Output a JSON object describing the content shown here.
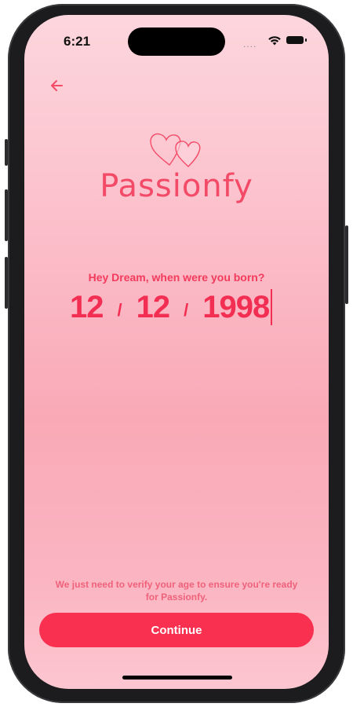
{
  "status_bar": {
    "time": "6:21",
    "signal": "....",
    "wifi_icon": "wifi-icon",
    "battery_icon": "battery-icon"
  },
  "nav": {
    "back_icon": "arrow-left-icon"
  },
  "brand": {
    "logo_icon": "two-hearts-icon",
    "name": "Passionfy",
    "color": "#f34a67"
  },
  "birthday": {
    "prompt": "Hey Dream, when were you born?",
    "day": "12",
    "month": "12",
    "year": "1998",
    "separator": "/"
  },
  "footer": {
    "note": "We just need to verify your age to ensure you're ready for Passionfy.",
    "continue_label": "Continue",
    "accent_color": "#f9304f"
  }
}
